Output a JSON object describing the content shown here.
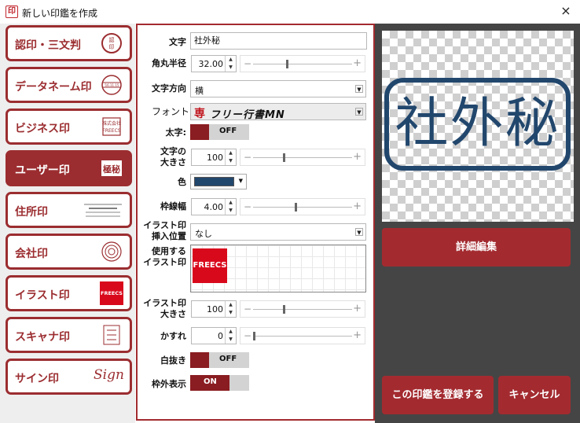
{
  "window": {
    "title": "新しい印鑑を作成",
    "icon_text": "印",
    "close": "×"
  },
  "sidebar": {
    "items": [
      {
        "label": "認印・三文判",
        "thumb": "認印"
      },
      {
        "label": "データネーム印",
        "thumb": "データ"
      },
      {
        "label": "ビジネス印",
        "thumb": "株式会社FREECS"
      },
      {
        "label": "ユーザー印",
        "thumb": "極秘"
      },
      {
        "label": "住所印",
        "thumb": ""
      },
      {
        "label": "会社印",
        "thumb": ""
      },
      {
        "label": "イラスト印",
        "thumb": "FREECS"
      },
      {
        "label": "スキャナ印",
        "thumb": ""
      },
      {
        "label": "サイン印",
        "thumb": "Sign"
      }
    ],
    "active_index": 3
  },
  "form": {
    "text": {
      "label": "文字",
      "value": "社外秘"
    },
    "corner_radius": {
      "label": "角丸半径",
      "value": "32.00",
      "level": 0.33
    },
    "text_direction": {
      "label": "文字方向",
      "value": "横"
    },
    "font": {
      "label": "フォント",
      "value": "フリー行書MN",
      "icon": "専"
    },
    "bold": {
      "label": "太字:",
      "state": "OFF"
    },
    "text_size": {
      "label1": "文字の",
      "label2": "大きさ",
      "value": "100",
      "level": 0.3
    },
    "color": {
      "label": "色",
      "value": "#22476d"
    },
    "border_width": {
      "label": "枠線幅",
      "value": "4.00",
      "level": 0.42
    },
    "illust_position": {
      "label1": "イラスト印",
      "label2": "挿入位置",
      "value": "なし"
    },
    "illust_used": {
      "label1": "使用する",
      "label2": "イラスト印",
      "thumb": "FREECS"
    },
    "illust_size": {
      "label1": "イラスト印",
      "label2": "大きさ",
      "value": "100",
      "level": 0.3
    },
    "blur": {
      "label": "かすれ",
      "value": "0",
      "level": 0.0
    },
    "white_out": {
      "label": "白抜き",
      "state": "OFF"
    },
    "outer_display": {
      "label": "枠外表示",
      "state": "ON"
    }
  },
  "preview": {
    "stamp_text": "社外秘",
    "stamp_color": "#22476d"
  },
  "buttons": {
    "detail_edit": "詳細編集",
    "register": "この印鑑を登録する",
    "cancel": "キャンセル"
  },
  "colors": {
    "accent": "#a32b30",
    "sidebar_bg": "#eeeeee",
    "right_bg": "#454545"
  }
}
